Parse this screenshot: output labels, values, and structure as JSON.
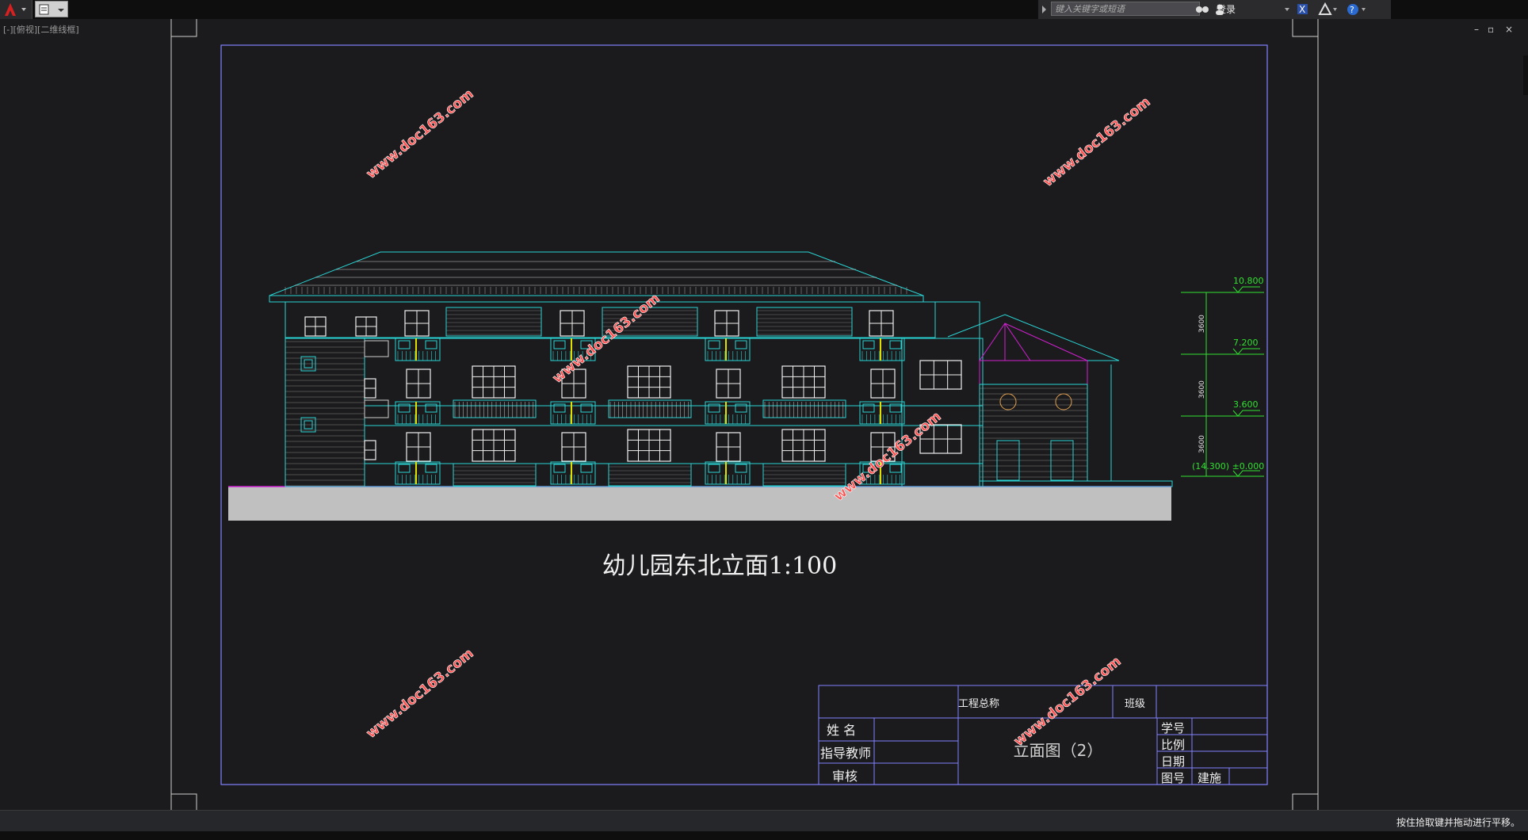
{
  "app": {
    "search_placeholder": "键入关键字或短语",
    "login_label": "登录",
    "view_label": "[-][俯视][二维线框]",
    "status_text": "按住拾取键并拖动进行平移。"
  },
  "drawing": {
    "title": "幼儿园东北立面1:100",
    "watermark": "www.doc163.com",
    "levels": [
      {
        "label": "10.800"
      },
      {
        "label": "7.200"
      },
      {
        "label": "3.600"
      },
      {
        "label": "(14.300) ±0.000"
      }
    ],
    "floor_dims": [
      "3600",
      "3600",
      "3600"
    ]
  },
  "title_block": {
    "project_label": "工程总称",
    "class_label": "班级",
    "name_label": "姓 名",
    "advisor_label": "指导教师",
    "review_label": "审核",
    "drawing_name": "立面图（2）",
    "student_id_label": "学号",
    "scale_label": "比例",
    "date_label": "日期",
    "drawing_no_label": "图号",
    "drawing_no_value": "建施"
  },
  "colors": {
    "cyan": "#2ad4d4",
    "white": "#f0f0f0",
    "magenta": "#d020d0",
    "green": "#30e030",
    "yellow": "#e0e000",
    "frame": "#8080ff",
    "ground": "#c0c0c0",
    "watermark": "#ff5050"
  }
}
